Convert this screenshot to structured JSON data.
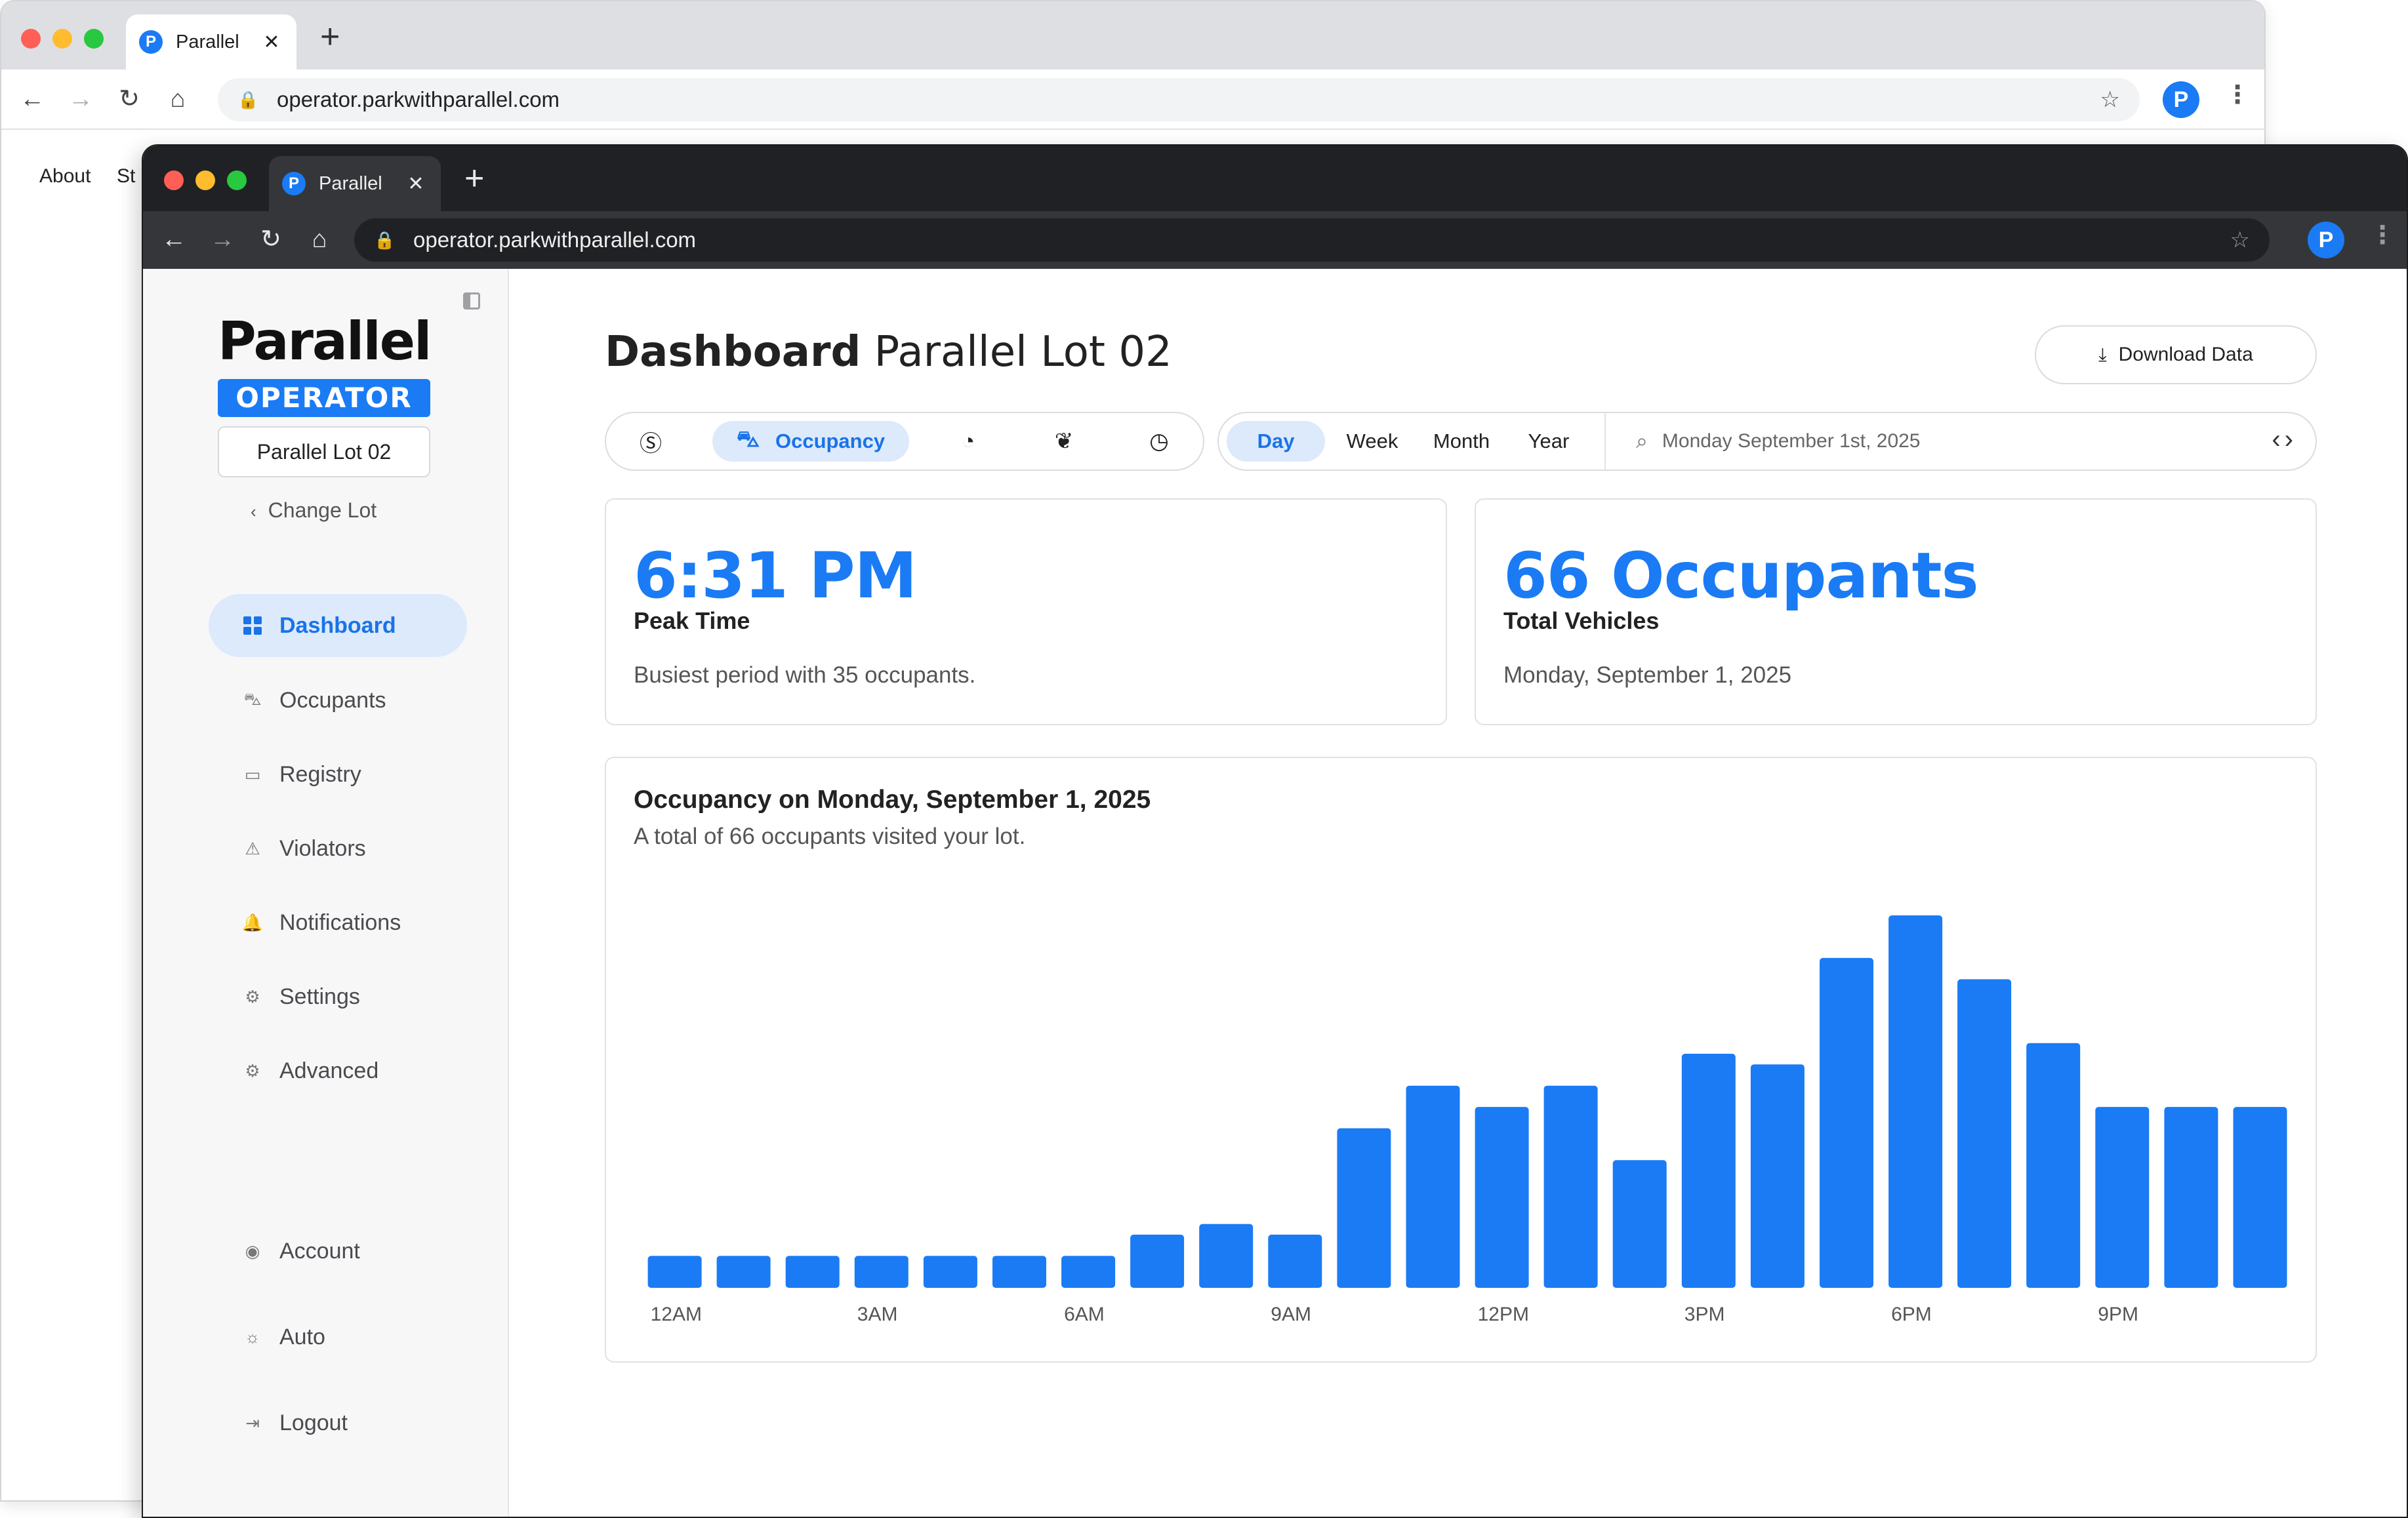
{
  "back_browser": {
    "tab_title": "Parallel",
    "tab_logo": "P",
    "new_tab": "+",
    "tab_close": "✕",
    "url": "operator.parkwithparallel.com",
    "profile": "P",
    "links": [
      "About",
      "St"
    ]
  },
  "front_browser": {
    "tab_title": "Parallel",
    "tab_logo": "P",
    "new_tab": "+",
    "tab_close": "✕",
    "url": "operator.parkwithparallel.com",
    "profile": "P"
  },
  "sidebar": {
    "brand": "Parallel",
    "badge": "OPERATOR",
    "lot": "Parallel Lot 02",
    "change_lot": "Change Lot",
    "items": [
      {
        "label": "Dashboard",
        "icon": "grid-icon",
        "active": true
      },
      {
        "label": "Occupants",
        "icon": "car-icon"
      },
      {
        "label": "Registry",
        "icon": "card-icon"
      },
      {
        "label": "Violators",
        "icon": "warning-icon"
      },
      {
        "label": "Notifications",
        "icon": "bell-icon"
      },
      {
        "label": "Settings",
        "icon": "gear-icon"
      },
      {
        "label": "Advanced",
        "icon": "gear-icon"
      }
    ],
    "bottom_items": [
      {
        "label": "Account",
        "icon": "user-circle-icon"
      },
      {
        "label": "Auto",
        "icon": "sun-icon"
      },
      {
        "label": "Logout",
        "icon": "logout-icon"
      }
    ]
  },
  "header": {
    "title_bold": "Dashboard",
    "title_rest": "Parallel Lot 02",
    "download_label": "Download Data"
  },
  "metric_tabs": {
    "active_label": "Occupancy",
    "icons": [
      "dollar-icon",
      "car-icon",
      "pie-chart-icon",
      "leaf-icon",
      "clock-icon"
    ]
  },
  "period": {
    "options": [
      "Day",
      "Week",
      "Month",
      "Year"
    ],
    "active": "Day",
    "date_value": "Monday September 1st, 2025"
  },
  "stats": {
    "peak_time": "6:31 PM",
    "peak_label": "Peak Time",
    "peak_desc": "Busiest period with 35 occupants.",
    "occupants": "66 Occupants",
    "occupants_label": "Total Vehicles",
    "occupants_date": "Monday, September 1, 2025"
  },
  "chart_card": {
    "title": "Occupancy on Monday, September 1, 2025",
    "subtitle": "A total of 66 occupants visited your lot."
  },
  "colors": {
    "accent": "#1a7bf5",
    "active_bg": "#dceafb",
    "bar": "#1a7bf5"
  },
  "chart_data": {
    "type": "bar",
    "categories": [
      "12AM",
      "1AM",
      "2AM",
      "3AM",
      "4AM",
      "5AM",
      "6AM",
      "7AM",
      "8AM",
      "9AM",
      "10AM",
      "11AM",
      "12PM",
      "1PM",
      "2PM",
      "3PM",
      "4PM",
      "5PM",
      "6PM",
      "7PM",
      "8PM",
      "9PM",
      "10PM",
      "11PM"
    ],
    "tick_labels": [
      {
        "index": 0,
        "label": "12AM"
      },
      {
        "index": 3,
        "label": "3AM"
      },
      {
        "index": 6,
        "label": "6AM"
      },
      {
        "index": 9,
        "label": "9AM"
      },
      {
        "index": 12,
        "label": "12PM"
      },
      {
        "index": 15,
        "label": "3PM"
      },
      {
        "index": 18,
        "label": "6PM"
      },
      {
        "index": 21,
        "label": "9PM"
      }
    ],
    "values": [
      3,
      3,
      3,
      3,
      3,
      3,
      3,
      5,
      6,
      5,
      15,
      19,
      17,
      19,
      12,
      22,
      21,
      31,
      35,
      29,
      23,
      17,
      17,
      17
    ],
    "ylim": [
      0,
      35
    ],
    "grid": false,
    "xlabel": "",
    "ylabel": ""
  }
}
